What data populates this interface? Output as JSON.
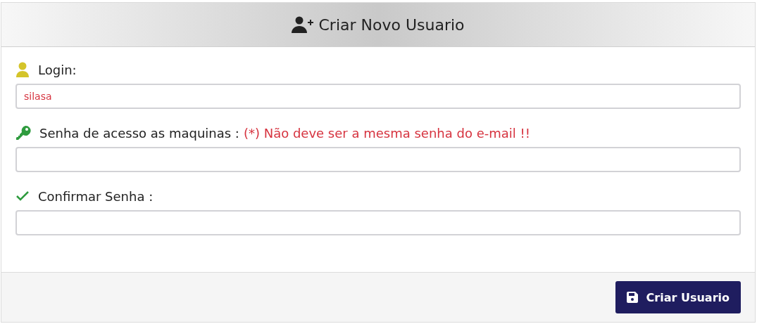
{
  "header": {
    "title": "Criar Novo Usuario"
  },
  "fields": [
    {
      "kind": "user",
      "label": "Login:",
      "value": "silasa"
    },
    {
      "kind": "key",
      "label": "Senha de acesso as maquinas :",
      "warning": "(*) Não deve ser a mesma senha do e-mail !!"
    },
    {
      "kind": "check",
      "label": "Confirmar Senha :"
    }
  ],
  "submit": {
    "label": "Criar Usuario"
  }
}
